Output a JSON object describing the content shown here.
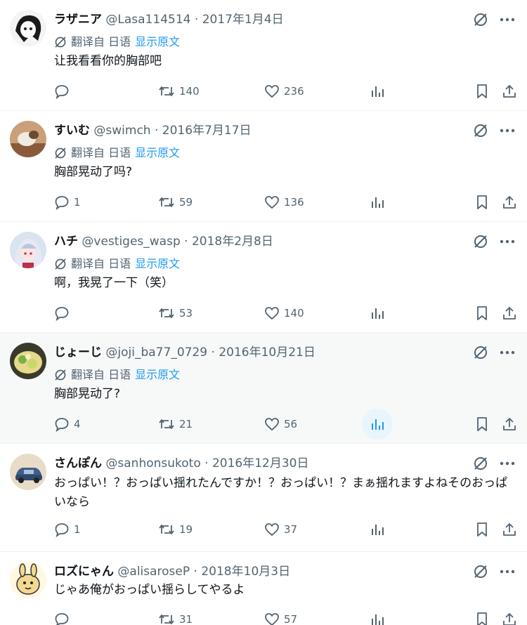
{
  "colors": {
    "text": "#0f1419",
    "muted": "#536471",
    "link": "#1d9bf0",
    "hover_bg": "#f7f9f9",
    "views_active": "#1d9bf0"
  },
  "translate": {
    "label": "翻译自 日语",
    "show_original": "显示原文"
  },
  "icons": {
    "reply": "reply-icon",
    "retweet": "retweet-icon",
    "like": "like-icon",
    "views": "views-icon",
    "bookmark": "bookmark-icon",
    "share": "share-icon",
    "translate": "translate-icon",
    "more": "more-icon"
  },
  "tweets": [
    {
      "name": "ラザニア",
      "handle": "@Lasa114514",
      "date": "2017年1月4日",
      "text": "让我看看你的胸部吧",
      "replies": "",
      "retweets": "140",
      "likes": "236"
    },
    {
      "name": "すいむ",
      "handle": "@swimch",
      "date": "2016年7月17日",
      "text": "胸部晃动了吗?",
      "replies": "1",
      "retweets": "59",
      "likes": "136"
    },
    {
      "name": "ハチ",
      "handle": "@vestiges_wasp",
      "date": "2018年2月8日",
      "text": "啊，我晃了一下（笑）",
      "replies": "",
      "retweets": "53",
      "likes": "140"
    },
    {
      "name": "じょーじ",
      "handle": "@joji_ba77_0729",
      "date": "2016年10月21日",
      "text": "胸部晃动了?",
      "replies": "4",
      "retweets": "21",
      "likes": "56"
    },
    {
      "name": "さんぽん",
      "handle": "@sanhonsukoto",
      "date": "2016年12月30日",
      "text": "おっぱい！？おっぱい揺れたんですか！？おっぱい！？まぁ揺れますよねそのおっぱいなら",
      "replies": "1",
      "retweets": "19",
      "likes": "37"
    },
    {
      "name": "ロズにゃん",
      "handle": "@alisaroseP",
      "date": "2018年10月3日",
      "text": "じゃあ俺がおっぱい揺らしてやるよ",
      "replies": "",
      "retweets": "31",
      "likes": "57"
    }
  ]
}
